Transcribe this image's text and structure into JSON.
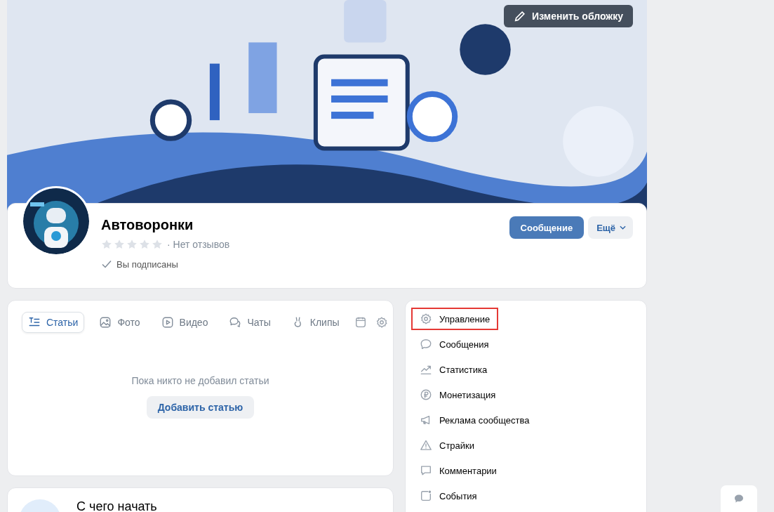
{
  "cover": {
    "edit_button": "Изменить обложку"
  },
  "profile": {
    "name": "Автоворонки",
    "stars": 0,
    "reviews": "· Нет отзывов",
    "subscribed": true,
    "subscribed_label": "Вы подписаны",
    "message_button": "Сообщение",
    "more_button": "Ещё"
  },
  "tabs": [
    {
      "label": "Статьи",
      "selected": true
    },
    {
      "label": "Фото",
      "selected": false
    },
    {
      "label": "Видео",
      "selected": false
    },
    {
      "label": "Чаты",
      "selected": false
    },
    {
      "label": "Клипы",
      "selected": false
    }
  ],
  "empty_state": {
    "text": "Пока никто не добавил статьи",
    "button": "Добавить статью"
  },
  "getting_started": {
    "title": "С чего начать"
  },
  "menu": [
    {
      "label": "Управление",
      "highlighted": true
    },
    {
      "label": "Сообщения",
      "highlighted": false
    },
    {
      "label": "Статистика",
      "highlighted": false
    },
    {
      "label": "Монетизация",
      "highlighted": false
    },
    {
      "label": "Реклама сообщества",
      "highlighted": false
    },
    {
      "label": "Страйки",
      "highlighted": false
    },
    {
      "label": "Комментарии",
      "highlighted": false
    },
    {
      "label": "События",
      "highlighted": false
    }
  ]
}
